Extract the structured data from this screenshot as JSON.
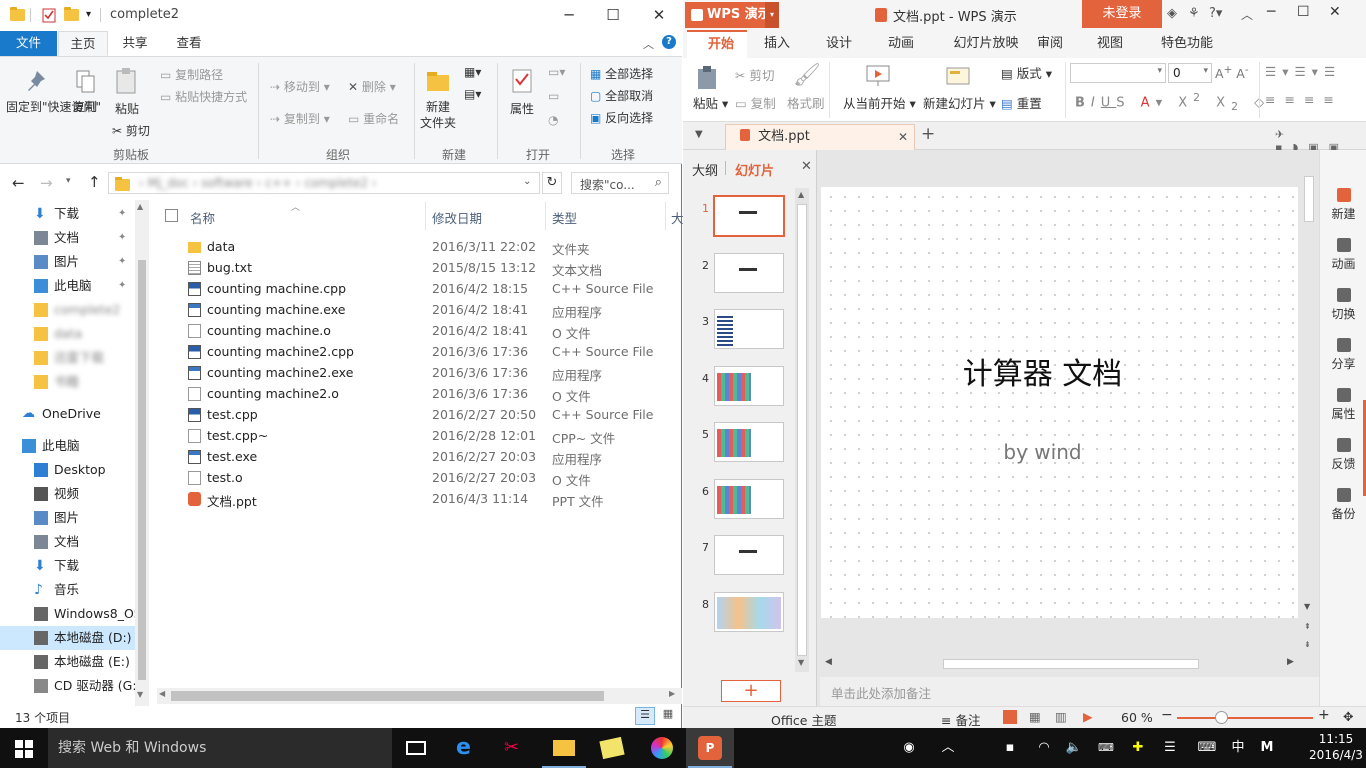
{
  "explorer": {
    "title": "complete2",
    "tabs": [
      "文件",
      "主页",
      "共享",
      "查看"
    ],
    "ribbon": {
      "pin": "固定到\"快速访问\"",
      "copy": "复制",
      "paste": "粘贴",
      "copy_path": "复制路径",
      "paste_shortcut": "粘贴快捷方式",
      "cut": "剪切",
      "move_to": "移动到",
      "copy_to": "复制到",
      "delete": "删除",
      "rename": "重命名",
      "new_folder": "新建\n文件夹",
      "properties": "属性",
      "select_all": "全部选择",
      "select_none": "全部取消",
      "invert": "反向选择",
      "groups": [
        "剪贴板",
        "组织",
        "新建",
        "打开",
        "选择"
      ]
    },
    "search_placeholder": "搜索\"co...",
    "nav": [
      {
        "label": "下载",
        "icon": "download-icon",
        "pinned": true
      },
      {
        "label": "文档",
        "icon": "document-icon",
        "pinned": true
      },
      {
        "label": "图片",
        "icon": "picture-icon",
        "pinned": true
      },
      {
        "label": "此电脑",
        "icon": "computer-icon",
        "pinned": true
      },
      {
        "label": "complete2",
        "icon": "folder-icon",
        "blurred": true
      },
      {
        "label": "data",
        "icon": "folder-icon",
        "blurred": true
      },
      {
        "label": "迅雷下载",
        "icon": "folder-icon",
        "blurred": true
      },
      {
        "label": "书籍",
        "icon": "folder-icon",
        "blurred": true
      },
      {
        "label": "OneDrive",
        "icon": "cloud-icon"
      },
      {
        "label": "此电脑",
        "icon": "computer-icon"
      },
      {
        "label": "Desktop",
        "icon": "desktop-icon"
      },
      {
        "label": "视频",
        "icon": "video-icon"
      },
      {
        "label": "图片",
        "icon": "picture-icon"
      },
      {
        "label": "文档",
        "icon": "document-icon"
      },
      {
        "label": "下载",
        "icon": "download-icon"
      },
      {
        "label": "音乐",
        "icon": "music-icon"
      },
      {
        "label": "Windows8_OS",
        "icon": "drive-icon"
      },
      {
        "label": "本地磁盘 (D:)",
        "icon": "drive-icon",
        "selected": true
      },
      {
        "label": "本地磁盘 (E:)",
        "icon": "drive-icon"
      },
      {
        "label": "CD 驱动器 (G:)",
        "icon": "cd-icon"
      }
    ],
    "columns": {
      "name": "名称",
      "date": "修改日期",
      "type": "类型",
      "size": "大"
    },
    "files": [
      {
        "name": "data",
        "date": "2016/3/11 22:02",
        "type": "文件夹",
        "icon": "folder"
      },
      {
        "name": "bug.txt",
        "date": "2015/8/15 13:12",
        "type": "文本文档",
        "icon": "txt"
      },
      {
        "name": "counting machine.cpp",
        "date": "2016/4/2 18:15",
        "type": "C++ Source File",
        "icon": "cpp"
      },
      {
        "name": "counting machine.exe",
        "date": "2016/4/2 18:41",
        "type": "应用程序",
        "icon": "exe"
      },
      {
        "name": "counting machine.o",
        "date": "2016/4/2 18:41",
        "type": "O 文件",
        "icon": "blank"
      },
      {
        "name": "counting machine2.cpp",
        "date": "2016/3/6 17:36",
        "type": "C++ Source File",
        "icon": "cpp"
      },
      {
        "name": "counting machine2.exe",
        "date": "2016/3/6 17:36",
        "type": "应用程序",
        "icon": "exe"
      },
      {
        "name": "counting machine2.o",
        "date": "2016/3/6 17:36",
        "type": "O 文件",
        "icon": "blank"
      },
      {
        "name": "test.cpp",
        "date": "2016/2/27 20:50",
        "type": "C++ Source File",
        "icon": "cpp"
      },
      {
        "name": "test.cpp~",
        "date": "2016/2/28 12:01",
        "type": "CPP~ 文件",
        "icon": "blank"
      },
      {
        "name": "test.exe",
        "date": "2016/2/27 20:03",
        "type": "应用程序",
        "icon": "exe"
      },
      {
        "name": "test.o",
        "date": "2016/2/27 20:03",
        "type": "O 文件",
        "icon": "blank"
      },
      {
        "name": "文档.ppt",
        "date": "2016/4/3 11:14",
        "type": "PPT 文件",
        "icon": "ppt"
      }
    ],
    "status": "13 个项目"
  },
  "wps": {
    "brand": "WPS 演示",
    "doc_title": "文档.ppt - WPS 演示",
    "login": "未登录",
    "tabs": [
      "开始",
      "插入",
      "设计",
      "动画",
      "幻灯片放映",
      "审阅",
      "视图",
      "特色功能"
    ],
    "ribbon": {
      "paste": "粘贴",
      "cut": "剪切",
      "copy": "复制",
      "format_painter": "格式刷",
      "from_current": "从当前开始",
      "new_slide": "新建幻灯片",
      "layout": "版式",
      "reset": "重置",
      "font_size": "0"
    },
    "doc_tab": "文档.ppt",
    "panel_tabs": [
      "大纲",
      "幻灯片"
    ],
    "slide_numbers": [
      "1",
      "2",
      "3",
      "4",
      "5",
      "6",
      "7",
      "8"
    ],
    "slide": {
      "title": "计算器 文档",
      "subtitle": "by wind"
    },
    "notes_placeholder": "单击此处添加备注",
    "sidebar": [
      "新建",
      "动画",
      "切换",
      "分享",
      "属性",
      "反馈",
      "备份"
    ],
    "status": {
      "theme": "Office 主题",
      "notes": "备注",
      "zoom": "60 %"
    },
    "accent": "#e2633c"
  },
  "taskbar": {
    "search": "搜索 Web 和 Windows",
    "ime": "中",
    "time": "11:15",
    "date": "2016/4/3"
  }
}
